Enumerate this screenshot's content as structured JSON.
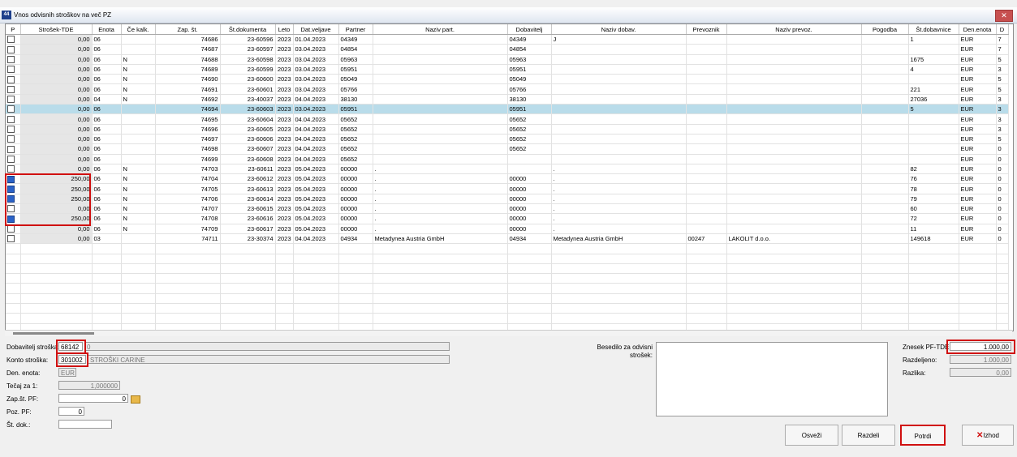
{
  "window": {
    "title": "Vnos odvisnih stroškov na več PZ",
    "app_icon_text": "44"
  },
  "columns": [
    "P",
    "Strošek-TDE",
    "Enota",
    "Če kalk.",
    "Zap. št.",
    "Št.dokumenta",
    "Leto",
    "Dat.veljave",
    "Partner",
    "Naziv part.",
    "Dobavitelj",
    "Naziv dobav.",
    "Prevoznik",
    "Naziv prevoz.",
    "Pogodba",
    "Št.dobavnice",
    "Den.enota",
    "D"
  ],
  "rows": [
    {
      "p": false,
      "strosek": "0,00",
      "enota": "06",
      "ce": "",
      "zap": "74686",
      "dok": "23-60596",
      "leto": "2023",
      "dat": "01.04.2023",
      "partner": "04349",
      "npart": "",
      "dob": "04349",
      "ndob": "J",
      "prev": "",
      "nprev": "",
      "pog": "",
      "dobav": "1",
      "den": "EUR",
      "d": "7"
    },
    {
      "p": false,
      "strosek": "0,00",
      "enota": "06",
      "ce": "",
      "zap": "74687",
      "dok": "23-60597",
      "leto": "2023",
      "dat": "03.04.2023",
      "partner": "04854",
      "npart": "",
      "dob": "04854",
      "ndob": "",
      "prev": "",
      "nprev": "",
      "pog": "",
      "dobav": "",
      "den": "EUR",
      "d": "7"
    },
    {
      "p": false,
      "strosek": "0,00",
      "enota": "06",
      "ce": "N",
      "zap": "74688",
      "dok": "23-60598",
      "leto": "2023",
      "dat": "03.04.2023",
      "partner": "05963",
      "npart": "",
      "dob": "05963",
      "ndob": "",
      "prev": "",
      "nprev": "",
      "pog": "",
      "dobav": "1675",
      "den": "EUR",
      "d": "5"
    },
    {
      "p": false,
      "strosek": "0,00",
      "enota": "06",
      "ce": "N",
      "zap": "74689",
      "dok": "23-60599",
      "leto": "2023",
      "dat": "03.04.2023",
      "partner": "05951",
      "npart": "",
      "dob": "05951",
      "ndob": "",
      "prev": "",
      "nprev": "",
      "pog": "",
      "dobav": "4",
      "den": "EUR",
      "d": "3"
    },
    {
      "p": false,
      "strosek": "0,00",
      "enota": "06",
      "ce": "N",
      "zap": "74690",
      "dok": "23-60600",
      "leto": "2023",
      "dat": "03.04.2023",
      "partner": "05049",
      "npart": "",
      "dob": "05049",
      "ndob": "",
      "prev": "",
      "nprev": "",
      "pog": "",
      "dobav": "",
      "den": "EUR",
      "d": "5"
    },
    {
      "p": false,
      "strosek": "0,00",
      "enota": "06",
      "ce": "N",
      "zap": "74691",
      "dok": "23-60601",
      "leto": "2023",
      "dat": "03.04.2023",
      "partner": "05766",
      "npart": "",
      "dob": "05766",
      "ndob": "",
      "prev": "",
      "nprev": "",
      "pog": "",
      "dobav": "221",
      "den": "EUR",
      "d": "5"
    },
    {
      "p": false,
      "strosek": "0,00",
      "enota": "04",
      "ce": "N",
      "zap": "74692",
      "dok": "23-40037",
      "leto": "2023",
      "dat": "04.04.2023",
      "partner": "38130",
      "npart": "",
      "dob": "38130",
      "ndob": "",
      "prev": "",
      "nprev": "",
      "pog": "",
      "dobav": "27036",
      "den": "EUR",
      "d": "3"
    },
    {
      "p": false,
      "strosek": "0,00",
      "enota": "06",
      "ce": "",
      "zap": "74694",
      "dok": "23-60603",
      "leto": "2023",
      "dat": "03.04.2023",
      "partner": "05951",
      "npart": "",
      "dob": "05951",
      "ndob": "",
      "prev": "",
      "nprev": "",
      "pog": "",
      "dobav": "5",
      "den": "EUR",
      "d": "3",
      "selected": true
    },
    {
      "p": false,
      "strosek": "0,00",
      "enota": "06",
      "ce": "",
      "zap": "74695",
      "dok": "23-60604",
      "leto": "2023",
      "dat": "04.04.2023",
      "partner": "05652",
      "npart": "",
      "dob": "05652",
      "ndob": "",
      "prev": "",
      "nprev": "",
      "pog": "",
      "dobav": "",
      "den": "EUR",
      "d": "3"
    },
    {
      "p": false,
      "strosek": "0,00",
      "enota": "06",
      "ce": "",
      "zap": "74696",
      "dok": "23-60605",
      "leto": "2023",
      "dat": "04.04.2023",
      "partner": "05652",
      "npart": "",
      "dob": "05652",
      "ndob": "",
      "prev": "",
      "nprev": "",
      "pog": "",
      "dobav": "",
      "den": "EUR",
      "d": "3"
    },
    {
      "p": false,
      "strosek": "0,00",
      "enota": "06",
      "ce": "",
      "zap": "74697",
      "dok": "23-60606",
      "leto": "2023",
      "dat": "04.04.2023",
      "partner": "05652",
      "npart": "",
      "dob": "05652",
      "ndob": "",
      "prev": "",
      "nprev": "",
      "pog": "",
      "dobav": "",
      "den": "EUR",
      "d": "5"
    },
    {
      "p": false,
      "strosek": "0,00",
      "enota": "06",
      "ce": "",
      "zap": "74698",
      "dok": "23-60607",
      "leto": "2023",
      "dat": "04.04.2023",
      "partner": "05652",
      "npart": "",
      "dob": "05652",
      "ndob": "",
      "prev": "",
      "nprev": "",
      "pog": "",
      "dobav": "",
      "den": "EUR",
      "d": "0"
    },
    {
      "p": false,
      "strosek": "0,00",
      "enota": "06",
      "ce": "",
      "zap": "74699",
      "dok": "23-60608",
      "leto": "2023",
      "dat": "04.04.2023",
      "partner": "05652",
      "npart": "",
      "dob": "",
      "ndob": "",
      "prev": "",
      "nprev": "",
      "pog": "",
      "dobav": "",
      "den": "EUR",
      "d": "0"
    },
    {
      "p": false,
      "strosek": "0,00",
      "enota": "06",
      "ce": "N",
      "zap": "74703",
      "dok": "23-60611",
      "leto": "2023",
      "dat": "05.04.2023",
      "partner": "00000",
      "npart": ".",
      "dob": "",
      "ndob": ".",
      "prev": "",
      "nprev": "",
      "pog": "",
      "dobav": "82",
      "den": "EUR",
      "d": "0"
    },
    {
      "p": true,
      "strosek": "250,00",
      "enota": "06",
      "ce": "N",
      "zap": "74704",
      "dok": "23-60612",
      "leto": "2023",
      "dat": "05.04.2023",
      "partner": "00000",
      "npart": ".",
      "dob": "00000",
      "ndob": ".",
      "prev": "",
      "nprev": "",
      "pog": "",
      "dobav": "76",
      "den": "EUR",
      "d": "0"
    },
    {
      "p": true,
      "strosek": "250,00",
      "enota": "06",
      "ce": "N",
      "zap": "74705",
      "dok": "23-60613",
      "leto": "2023",
      "dat": "05.04.2023",
      "partner": "00000",
      "npart": ".",
      "dob": "00000",
      "ndob": ".",
      "prev": "",
      "nprev": "",
      "pog": "",
      "dobav": "78",
      "den": "EUR",
      "d": "0"
    },
    {
      "p": true,
      "strosek": "250,00",
      "enota": "06",
      "ce": "N",
      "zap": "74706",
      "dok": "23-60614",
      "leto": "2023",
      "dat": "05.04.2023",
      "partner": "00000",
      "npart": ".",
      "dob": "00000",
      "ndob": ".",
      "prev": "",
      "nprev": "",
      "pog": "",
      "dobav": "79",
      "den": "EUR",
      "d": "0"
    },
    {
      "p": false,
      "strosek": "0,00",
      "enota": "06",
      "ce": "N",
      "zap": "74707",
      "dok": "23-60615",
      "leto": "2023",
      "dat": "05.04.2023",
      "partner": "00000",
      "npart": ".",
      "dob": "00000",
      "ndob": ".",
      "prev": "",
      "nprev": "",
      "pog": "",
      "dobav": "60",
      "den": "EUR",
      "d": "0"
    },
    {
      "p": true,
      "strosek": "250,00",
      "enota": "06",
      "ce": "N",
      "zap": "74708",
      "dok": "23-60616",
      "leto": "2023",
      "dat": "05.04.2023",
      "partner": "00000",
      "npart": ".",
      "dob": "00000",
      "ndob": ".",
      "prev": "",
      "nprev": "",
      "pog": "",
      "dobav": "72",
      "den": "EUR",
      "d": "0"
    },
    {
      "p": false,
      "strosek": "0,00",
      "enota": "06",
      "ce": "N",
      "zap": "74709",
      "dok": "23-60617",
      "leto": "2023",
      "dat": "05.04.2023",
      "partner": "00000",
      "npart": ".",
      "dob": "00000",
      "ndob": ".",
      "prev": "",
      "nprev": "",
      "pog": "",
      "dobav": "11",
      "den": "EUR",
      "d": "0"
    },
    {
      "p": false,
      "strosek": "0,00",
      "enota": "03",
      "ce": "",
      "zap": "74711",
      "dok": "23-30374",
      "leto": "2023",
      "dat": "04.04.2023",
      "partner": "04934",
      "npart": "Metadynea Austria GmbH",
      "dob": "04934",
      "ndob": "Metadynea Austria GmbH",
      "prev": "00247",
      "nprev": "LAKOLIT d.o.o.",
      "pog": "",
      "dobav": "149618",
      "den": "EUR",
      "d": "0"
    }
  ],
  "form": {
    "dobavitelj_label": "Dobavitelj stroška:",
    "dobavitelj_code": "68142",
    "dobavitelj_name": "0",
    "konto_label": "Konto stroška:",
    "konto_code": "301002",
    "konto_name": "STROŠKI CARINE",
    "den_label": "Den. enota:",
    "den_value": "EUR",
    "tecaj_label": "Tečaj za 1:",
    "tecaj_value": "1,000000",
    "zap_label": "Zap.št. PF:",
    "zap_value": "0",
    "poz_label": "Poz. PF:",
    "poz_value": "0",
    "stdok_label": "Št. dok.:",
    "stdok_value": "",
    "besedilo_label": "Besedilo za odvisni strošek:",
    "besedilo_value": "",
    "znesek_label": "Znesek PF-TDE:",
    "znesek_value": "1.000,00",
    "razdeljeno_label": "Razdeljeno:",
    "razdeljeno_value": "1.000,00",
    "razlika_label": "Razlika:",
    "razlika_value": "0,00"
  },
  "buttons": {
    "osvezi": "Osveži",
    "razdeli": "Razdeli",
    "potrdi": "Potrdi",
    "izhod": "Izhod"
  },
  "colors": {
    "selected_row": "#b9dcea",
    "highlight": "#d01010",
    "checked": "#2b63c8"
  }
}
